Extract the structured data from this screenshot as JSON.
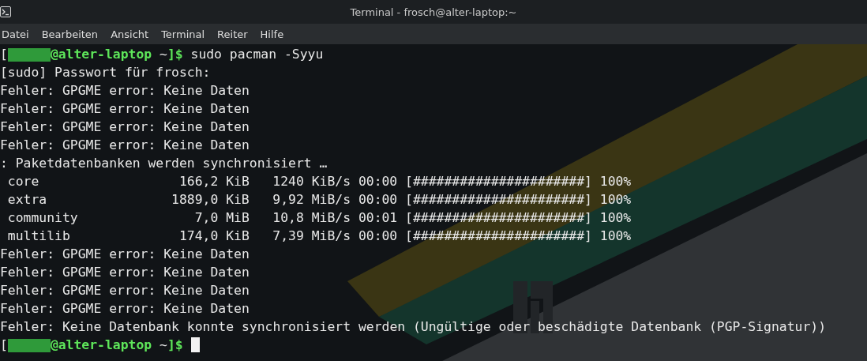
{
  "window": {
    "title": "Terminal - frosch@alter-laptop:~"
  },
  "menu": [
    "Datei",
    "Bearbeiten",
    "Ansicht",
    "Terminal",
    "Reiter",
    "Hilfe"
  ],
  "lines": [
    {
      "kind": "prompt",
      "open": "[",
      "user_redacted": true,
      "host": "@alter-laptop",
      "dir": "~",
      "close": "]$",
      "command": "sudo pacman -Syyu",
      "cursor": false
    },
    {
      "kind": "text",
      "text": "[sudo] Passwort für frosch:"
    },
    {
      "kind": "text",
      "text": "Fehler: GPGME error: Keine Daten"
    },
    {
      "kind": "text",
      "text": "Fehler: GPGME error: Keine Daten"
    },
    {
      "kind": "text",
      "text": "Fehler: GPGME error: Keine Daten"
    },
    {
      "kind": "text",
      "text": "Fehler: GPGME error: Keine Daten"
    },
    {
      "kind": "text",
      "text": ": Paketdatenbanken werden synchronisiert …"
    },
    {
      "kind": "progress",
      "name": "core",
      "size": "166,2 KiB",
      "speed": "1240 KiB/s",
      "time": "00:00",
      "bar": "[######################]",
      "percent": "100%"
    },
    {
      "kind": "progress",
      "name": "extra",
      "size": "1889,0 KiB",
      "speed": "9,92 MiB/s",
      "time": "00:00",
      "bar": "[######################]",
      "percent": "100%"
    },
    {
      "kind": "progress",
      "name": "community",
      "size": "7,0 MiB",
      "speed": "10,8 MiB/s",
      "time": "00:01",
      "bar": "[######################]",
      "percent": "100%"
    },
    {
      "kind": "progress",
      "name": "multilib",
      "size": "174,0 KiB",
      "speed": "7,39 MiB/s",
      "time": "00:00",
      "bar": "[######################]",
      "percent": "100%"
    },
    {
      "kind": "text",
      "text": "Fehler: GPGME error: Keine Daten"
    },
    {
      "kind": "text",
      "text": "Fehler: GPGME error: Keine Daten"
    },
    {
      "kind": "text",
      "text": "Fehler: GPGME error: Keine Daten"
    },
    {
      "kind": "text",
      "text": "Fehler: GPGME error: Keine Daten"
    },
    {
      "kind": "text",
      "text": "Fehler: Keine Datenbank konnte synchronisiert werden (Ungültige oder beschädigte Datenbank (PGP-Signatur))"
    },
    {
      "kind": "prompt",
      "open": "[",
      "user_redacted": true,
      "host": "@alter-laptop",
      "dir": "~",
      "close": "]$",
      "cursor": true
    }
  ]
}
